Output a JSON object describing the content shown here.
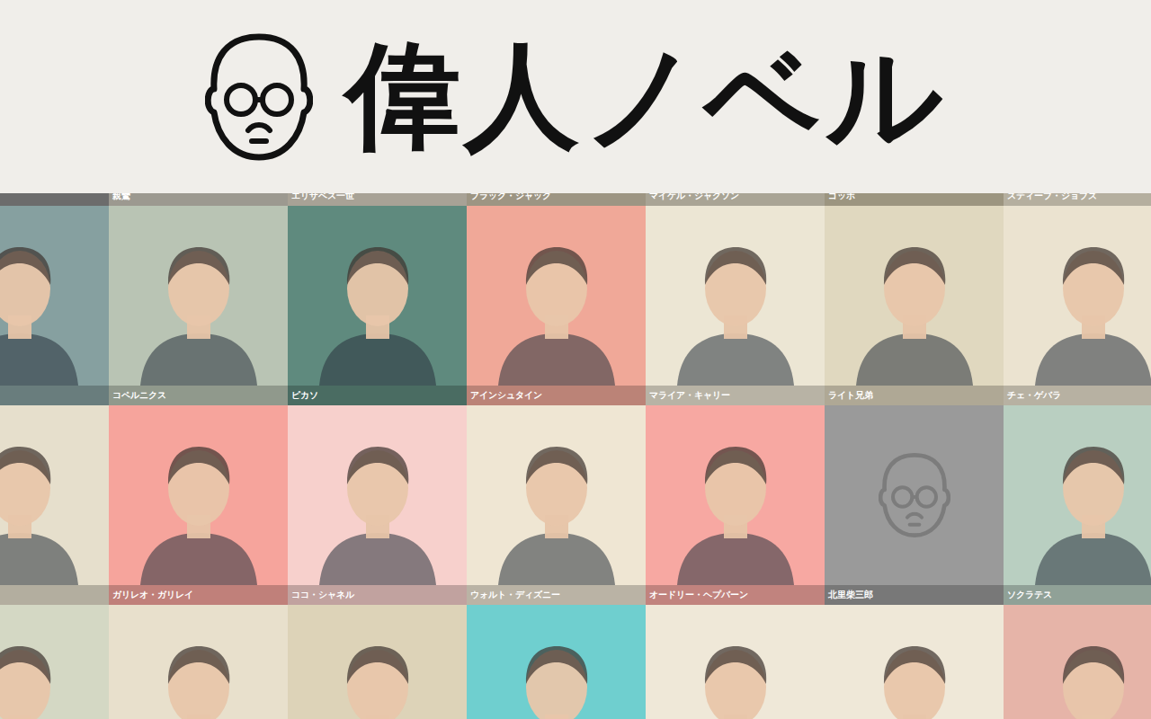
{
  "header": {
    "logo_text": "偉人ノベル"
  },
  "grid": {
    "rows": [
      {
        "cells": [
          {
            "name": "",
            "color": "#8a8a8a",
            "kind": "portrait"
          },
          {
            "name": "親鸞",
            "color": "#c8c4b8",
            "kind": "portrait"
          },
          {
            "name": "エリザベス一世",
            "color": "#d8d0c0",
            "kind": "portrait"
          },
          {
            "name": "ブラック・ジャック",
            "color": "#c9bfa8",
            "kind": "portrait"
          },
          {
            "name": "マイケル・ジャクソン",
            "color": "#d9d2bf",
            "kind": "portrait"
          },
          {
            "name": "ゴッホ",
            "color": "#c8bfa4",
            "kind": "portrait"
          },
          {
            "name": "スティーブ・ジョブズ",
            "color": "#e8e0cc",
            "kind": "portrait"
          }
        ]
      },
      {
        "cells": [
          {
            "name": "",
            "color": "#86a0a0",
            "kind": "portrait"
          },
          {
            "name": "コペルニクス",
            "color": "#b9c4b4",
            "kind": "portrait"
          },
          {
            "name": "ピカソ",
            "color": "#5f8a7e",
            "kind": "portrait"
          },
          {
            "name": "アインシュタイン",
            "color": "#f0a898",
            "kind": "portrait"
          },
          {
            "name": "マライア・キャリー",
            "color": "#ece6d4",
            "kind": "portrait"
          },
          {
            "name": "ライト兄弟",
            "color": "#e0d8bf",
            "kind": "portrait"
          },
          {
            "name": "チェ・ゲバラ",
            "color": "#ebe3d0",
            "kind": "portrait"
          }
        ]
      },
      {
        "cells": [
          {
            "name": "",
            "color": "#e6dfcc",
            "kind": "portrait"
          },
          {
            "name": "ガリレオ・ガリレイ",
            "color": "#f6a49c",
            "kind": "portrait"
          },
          {
            "name": "ココ・シャネル",
            "color": "#f7d0cc",
            "kind": "portrait"
          },
          {
            "name": "ウォルト・ディズニー",
            "color": "#efe6d3",
            "kind": "portrait"
          },
          {
            "name": "オードリー・ヘプバーン",
            "color": "#f7a8a2",
            "kind": "portrait"
          },
          {
            "name": "北里柴三郎",
            "color": "#9a9a9a",
            "kind": "placeholder"
          },
          {
            "name": "ソクラテス",
            "color": "#b9cfc1",
            "kind": "portrait"
          }
        ]
      },
      {
        "cells": [
          {
            "name": "",
            "color": "#d4d8c4",
            "kind": "portrait"
          },
          {
            "name": "",
            "color": "#e8e0cc",
            "kind": "portrait"
          },
          {
            "name": "",
            "color": "#ddd3b8",
            "kind": "portrait"
          },
          {
            "name": "",
            "color": "#6fcfcf",
            "kind": "portrait"
          },
          {
            "name": "",
            "color": "#efe8d8",
            "kind": "portrait"
          },
          {
            "name": "",
            "color": "#efe8d8",
            "kind": "portrait"
          },
          {
            "name": "",
            "color": "#e6b4a8",
            "kind": "portrait"
          }
        ]
      }
    ]
  }
}
